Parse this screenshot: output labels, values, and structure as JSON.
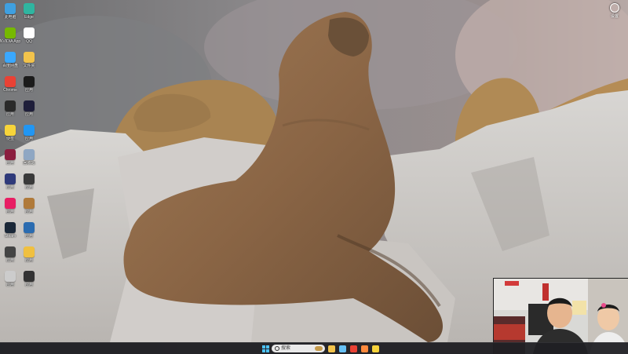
{
  "screen": {
    "wallpaper": "photo-of-sea-lions-on-rocks",
    "accent_color": "#4cc2ff"
  },
  "desktop_icons": [
    {
      "label": "此电脑",
      "icon": "computer-icon",
      "color": "#3fa0e0"
    },
    {
      "label": "Edge",
      "icon": "edge-icon",
      "color": "#2fb5a0"
    },
    {
      "label": "NVIDIA App",
      "icon": "nvidia-icon",
      "color": "#76b900"
    },
    {
      "label": "QQ",
      "icon": "qq-icon",
      "color": "#ffffff"
    },
    {
      "label": "百度网盘",
      "icon": "cloud-drive-icon",
      "color": "#3aa8ff"
    },
    {
      "label": "文件夹",
      "icon": "folder-icon",
      "color": "#f2c34b"
    },
    {
      "label": "Chrome",
      "icon": "chrome-icon",
      "color": "#e94235"
    },
    {
      "label": "应用",
      "icon": "app-icon",
      "color": "#1b1b1b"
    },
    {
      "label": "应用",
      "icon": "app-icon",
      "color": "#2a2a2a"
    },
    {
      "label": "应用",
      "icon": "app-icon",
      "color": "#1e1e3a"
    },
    {
      "label": "便签",
      "icon": "notes-icon",
      "color": "#f7d43a"
    },
    {
      "label": "应用",
      "icon": "app-icon",
      "color": "#2196f3"
    },
    {
      "label": "应用",
      "icon": "app-icon",
      "color": "#8b1e3f"
    },
    {
      "label": "回收站",
      "icon": "recycle-bin-icon",
      "color": "#8fa7c3"
    },
    {
      "label": "应用",
      "icon": "app-icon",
      "color": "#2f3a7a"
    },
    {
      "label": "应用",
      "icon": "app-icon",
      "color": "#3a3a3a"
    },
    {
      "label": "应用",
      "icon": "app-icon",
      "color": "#e81e63"
    },
    {
      "label": "应用",
      "icon": "app-icon",
      "color": "#b07a3a"
    },
    {
      "label": "Steam",
      "icon": "steam-icon",
      "color": "#1b2838"
    },
    {
      "label": "应用",
      "icon": "app-icon",
      "color": "#2b6cb0"
    },
    {
      "label": "应用",
      "icon": "app-icon",
      "color": "#444444"
    },
    {
      "label": "应用",
      "icon": "app-icon",
      "color": "#f0c040"
    },
    {
      "label": "应用",
      "icon": "app-icon",
      "color": "#cccccc"
    },
    {
      "label": "应用",
      "icon": "app-icon",
      "color": "#333333"
    }
  ],
  "corner_widget": {
    "label": "设置",
    "icon": "user-icon"
  },
  "taskbar": {
    "search_placeholder": "搜索",
    "apps": [
      {
        "icon": "file-explorer-icon",
        "color": "#f2c34b"
      },
      {
        "icon": "steam-icon",
        "color": "#66c0f4"
      },
      {
        "icon": "chrome-icon",
        "color": "#e94235"
      },
      {
        "icon": "app-icon",
        "color": "#ff8a3d"
      },
      {
        "icon": "app-icon",
        "color": "#f6d23a"
      }
    ]
  }
}
